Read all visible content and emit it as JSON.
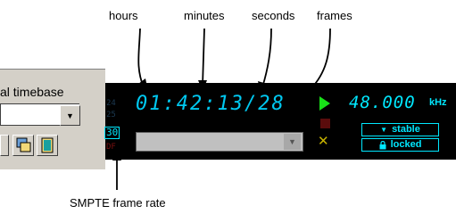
{
  "callouts": {
    "hours": "hours",
    "minutes": "minutes",
    "seconds": "seconds",
    "frames": "frames",
    "smpte": "SMPTE frame rate"
  },
  "panel": {
    "label": "al timebase"
  },
  "display": {
    "frame_rates": [
      "24",
      "25",
      "30",
      "DF"
    ],
    "active_rate": "30",
    "timecode": "01:42:13/28",
    "sample_rate": "48.000",
    "sample_unit": "kHz",
    "status_stable": "stable",
    "status_locked": "locked"
  },
  "colors": {
    "display_bg": "#000000",
    "digits": "#00c8f0",
    "play": "#18e018",
    "stop": "#5a0c0c",
    "cancel": "#c8b400",
    "panel": "#d4d0c8"
  },
  "icons": {
    "play": "play-icon",
    "stop": "stop-icon",
    "cancel": "x-icon",
    "dropdown": "chevron-down-icon",
    "lock": "lock-icon"
  }
}
